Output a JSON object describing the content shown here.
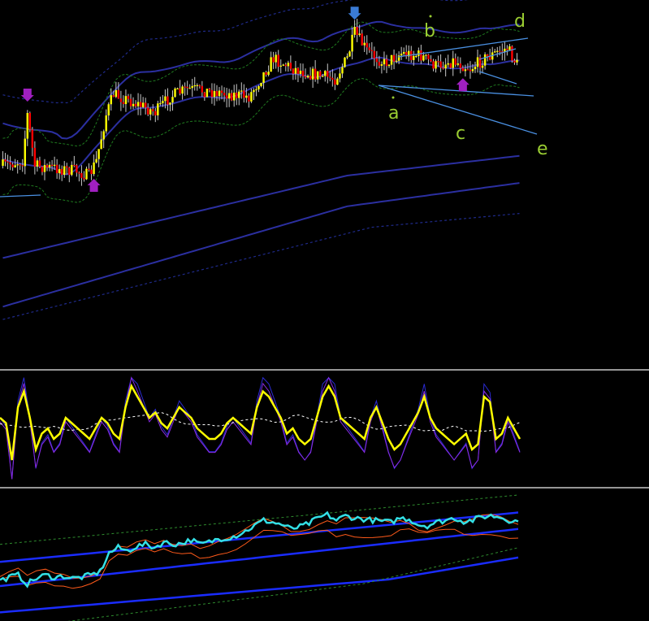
{
  "colors": {
    "background": "#000000",
    "separator": "#c8c8c8",
    "bull_candle": "#ffff00",
    "bear_candle": "#ff0000",
    "wick": "#c8c8c8",
    "band_main": "#2b2fa0",
    "band_dotted_blue": "#1f2a8a",
    "band_dotted_green": "#1f7a1f",
    "trendline": "#4a90e2",
    "arrow_down": "#3a7bd5",
    "arrow_purple": "#a020c0",
    "wave_label": "#9acd32",
    "osc_yellow": "#ffff00",
    "osc_blue": "#2a2ad0",
    "osc_purple": "#8a2be2",
    "osc_signal": "#ffffff",
    "ind_cyan": "#33e0e6",
    "ind_orange": "#ff5a1a",
    "ind_blue": "#1a2cff",
    "ind_green": "#2e8b2e"
  },
  "wave_labels": [
    {
      "text": "a"
    },
    {
      "text": "b"
    },
    {
      "text": "c"
    },
    {
      "text": "d"
    },
    {
      "text": "e"
    }
  ],
  "chart_data": [
    {
      "type": "candlestick",
      "panel": "price",
      "title": "",
      "bars": 210,
      "shape_points": [
        [
          0,
          0.6
        ],
        [
          8,
          0.58
        ],
        [
          10,
          0.4
        ],
        [
          13,
          0.6
        ],
        [
          30,
          0.62
        ],
        [
          35,
          0.64
        ],
        [
          38,
          0.58
        ],
        [
          42,
          0.4
        ],
        [
          45,
          0.32
        ],
        [
          55,
          0.36
        ],
        [
          62,
          0.39
        ],
        [
          68,
          0.33
        ],
        [
          75,
          0.3
        ],
        [
          85,
          0.31
        ],
        [
          100,
          0.33
        ],
        [
          110,
          0.18
        ],
        [
          118,
          0.22
        ],
        [
          125,
          0.24
        ],
        [
          135,
          0.26
        ],
        [
          140,
          0.18
        ],
        [
          143,
          0.08
        ],
        [
          148,
          0.15
        ],
        [
          155,
          0.2
        ],
        [
          162,
          0.16
        ],
        [
          170,
          0.17
        ],
        [
          176,
          0.21
        ],
        [
          183,
          0.19
        ],
        [
          190,
          0.22
        ],
        [
          196,
          0.18
        ],
        [
          205,
          0.14
        ],
        [
          210,
          0.22
        ]
      ],
      "arrows": [
        {
          "bar": 10,
          "kind": "down-purple"
        },
        {
          "bar": 37,
          "kind": "up-purple"
        },
        {
          "bar": 143,
          "kind": "down-blue"
        },
        {
          "bar": 187,
          "kind": "up-purple"
        }
      ]
    },
    {
      "type": "line",
      "panel": "oscillator",
      "title": "",
      "ylim": [
        0,
        100
      ],
      "series": [
        {
          "values": [
            60,
            55,
            20,
            70,
            85,
            60,
            30,
            45,
            50,
            40,
            45,
            60,
            55,
            50,
            45,
            40,
            50,
            60,
            55,
            45,
            40,
            70,
            90,
            80,
            70,
            60,
            65,
            55,
            50,
            60,
            70,
            65,
            60,
            50,
            45,
            40,
            40,
            45,
            55,
            60,
            55,
            50,
            45,
            70,
            85,
            80,
            70,
            60,
            45,
            50,
            40,
            35,
            40,
            60,
            80,
            90,
            80,
            60,
            55,
            50,
            45,
            40,
            60,
            70,
            55,
            40,
            30,
            35,
            45,
            55,
            65,
            80,
            60,
            50,
            45,
            40,
            35,
            40,
            45,
            30,
            35,
            80,
            75,
            40,
            45,
            60,
            50,
            40
          ]
        }
      ]
    },
    {
      "type": "line",
      "panel": "indicator",
      "title": "",
      "ylim": [
        0,
        100
      ],
      "series": [
        {
          "values": [
            25,
            28,
            30,
            22,
            27,
            30,
            28,
            29,
            27,
            28,
            30,
            33,
            50,
            55,
            52,
            56,
            58,
            55,
            60,
            58,
            59,
            62,
            58,
            60,
            63,
            64,
            66,
            70,
            75,
            80,
            78,
            76,
            72,
            74,
            77,
            82,
            85,
            80,
            84,
            82,
            81,
            80,
            79,
            78,
            82,
            81,
            76,
            75,
            78,
            80,
            82,
            79,
            80,
            83,
            84,
            83,
            80,
            79
          ]
        }
      ]
    }
  ]
}
